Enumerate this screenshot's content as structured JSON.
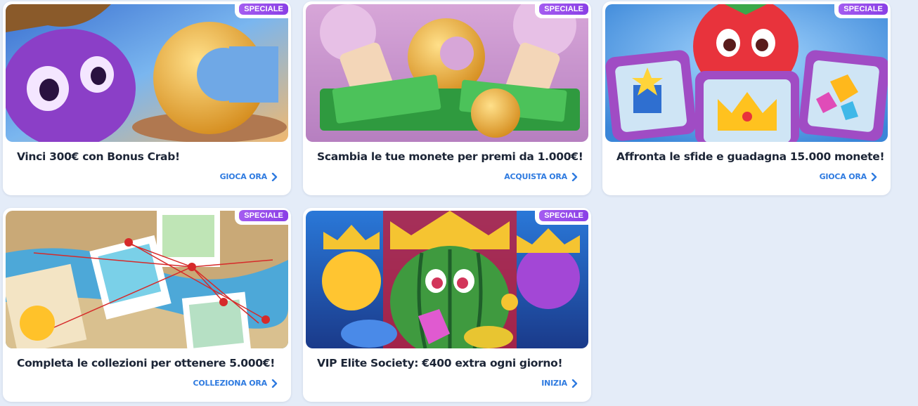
{
  "badge_label": "SPECIALE",
  "accent_color": "#2f7be0",
  "badge_color": "#9b4ee8",
  "promos": [
    {
      "title": "Vinci 300€ con Bonus Crab!",
      "cta": "GIOCA ORA",
      "badge": "SPECIALE"
    },
    {
      "title": "Scambia le tue monete per premi da 1.000€!",
      "cta": "ACQUISTA ORA",
      "badge": "SPECIALE"
    },
    {
      "title": "Affronta le sfide e guadagna 15.000 monete!",
      "cta": "GIOCA ORA",
      "badge": "SPECIALE"
    },
    {
      "title": "Completa le collezioni per ottenere 5.000€!",
      "cta": "COLLEZIONA ORA",
      "badge": "SPECIALE"
    },
    {
      "title": "VIP Elite Society: €400 extra ogni giorno!",
      "cta": "INIZIA",
      "badge": "SPECIALE"
    }
  ]
}
